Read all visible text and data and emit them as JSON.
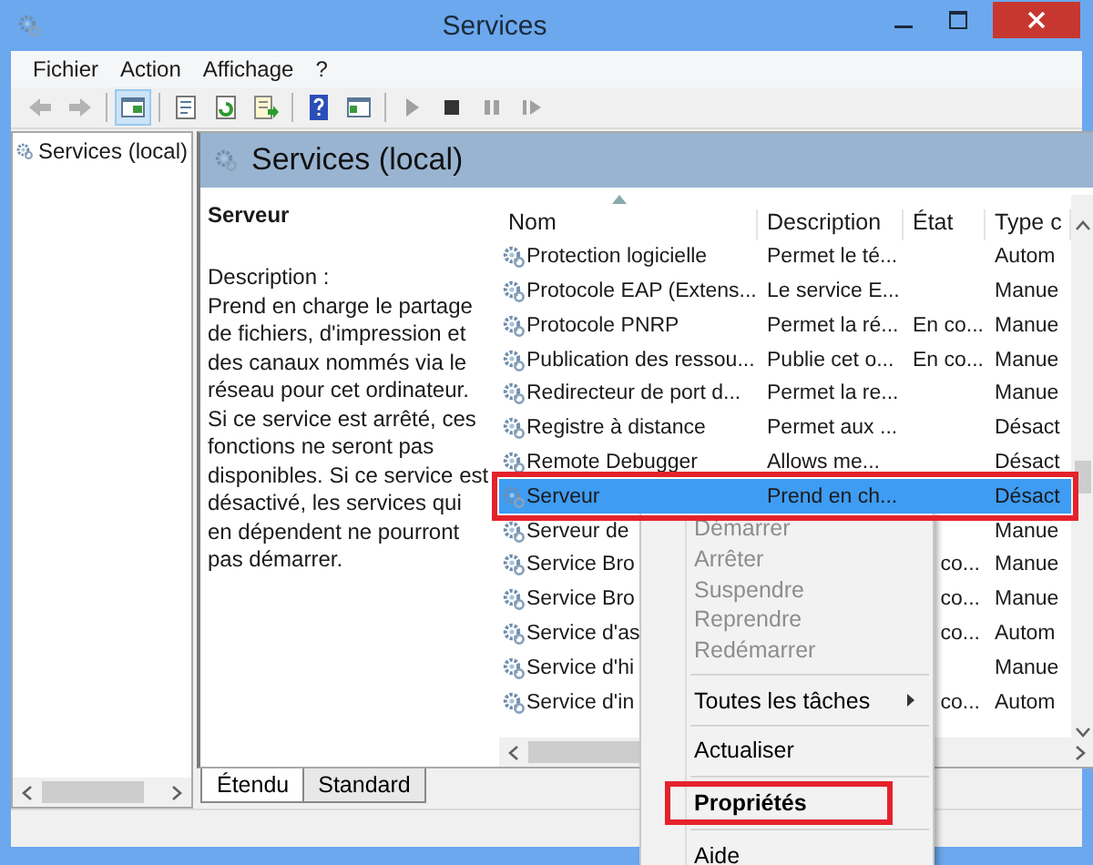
{
  "window": {
    "title": "Services",
    "controls": [
      {
        "kind": "minimize"
      },
      {
        "kind": "maximize"
      },
      {
        "kind": "close"
      }
    ]
  },
  "menu": [
    "Fichier",
    "Action",
    "Affichage",
    "?"
  ],
  "toolbar": [
    {
      "kind": "back",
      "disabled": true,
      "pressed": false
    },
    {
      "kind": "forward",
      "disabled": true,
      "pressed": false
    },
    {
      "kind": "separator"
    },
    {
      "kind": "tree",
      "pressed": true
    },
    {
      "kind": "separator"
    },
    {
      "kind": "properties",
      "pressed": false
    },
    {
      "kind": "refresh",
      "pressed": false
    },
    {
      "kind": "export",
      "pressed": false
    },
    {
      "kind": "separator"
    },
    {
      "kind": "help",
      "pressed": false
    },
    {
      "kind": "pane",
      "pressed": false
    },
    {
      "kind": "separator"
    },
    {
      "kind": "play",
      "disabled": true,
      "pressed": false
    },
    {
      "kind": "stop",
      "disabled": false,
      "pressed": false
    },
    {
      "kind": "pause",
      "disabled": true,
      "pressed": false
    },
    {
      "kind": "resume",
      "disabled": true,
      "pressed": false
    }
  ],
  "tree": {
    "items": [
      "Services (local)"
    ]
  },
  "pane": {
    "title": "Services (local)",
    "service_name": "Serveur",
    "description_label": "Description :",
    "description": "Prend en charge le partage de fichiers, d'impression et des canaux nommés via le réseau pour cet ordinateur. Si ce service est arrêté, ces fonctions ne seront pas disponibles. Si ce service est désactivé, les services qui en dépendent ne pourront pas démarrer."
  },
  "table": {
    "columns": [
      {
        "label": "Nom",
        "sorted": true
      },
      {
        "label": "Description",
        "sorted": false
      },
      {
        "label": "État",
        "sorted": false
      },
      {
        "label": "Type c",
        "sorted": false
      }
    ],
    "rows": [
      {
        "name": "Protection logicielle",
        "description": "Permet le té...",
        "startup": "Autom",
        "selected": false,
        "highlighted": false
      },
      {
        "name": "Protocole EAP (Extens...",
        "description": "Le service E...",
        "startup": "Manue",
        "selected": false,
        "highlighted": false
      },
      {
        "name": "Protocole PNRP",
        "description": "Permet la ré...",
        "state": "En co...",
        "startup": "Manue",
        "selected": false,
        "highlighted": false
      },
      {
        "name": "Publication des ressou...",
        "description": "Publie cet o...",
        "state": "En co...",
        "startup": "Manue",
        "selected": false,
        "highlighted": false
      },
      {
        "name": "Redirecteur de port d...",
        "description": "Permet la re...",
        "startup": "Manue",
        "selected": false,
        "highlighted": false
      },
      {
        "name": "Registre à distance",
        "description": "Permet aux ...",
        "startup": "Désact",
        "selected": false,
        "highlighted": false
      },
      {
        "name": "Remote Debugger",
        "description": "Allows me...",
        "startup": "Désact",
        "selected": false,
        "highlighted": false
      },
      {
        "name": "Serveur",
        "description": "Prend en ch...",
        "startup": "Désact",
        "selected": true,
        "highlighted": true
      },
      {
        "name": "Serveur de",
        "startup": "Manue",
        "selected": false,
        "highlighted": false
      },
      {
        "name": "Service Bro",
        "state": "co...",
        "startup": "Manue",
        "selected": false,
        "highlighted": false
      },
      {
        "name": "Service Bro",
        "state": "co...",
        "startup": "Manue",
        "selected": false,
        "highlighted": false
      },
      {
        "name": "Service d'as",
        "state": "co...",
        "startup": "Autom",
        "selected": false,
        "highlighted": false
      },
      {
        "name": "Service d'hi",
        "startup": "Manue",
        "selected": false,
        "highlighted": false
      },
      {
        "name": "Service d'in",
        "state": "co...",
        "startup": "Autom",
        "selected": false,
        "highlighted": false
      }
    ]
  },
  "view_tabs": [
    {
      "label": "Étendu",
      "selected": true
    },
    {
      "label": "Standard",
      "selected": false
    }
  ],
  "context_menu": [
    {
      "kind": "item",
      "label": "Démarrer",
      "disabled": true,
      "default": false,
      "submenu": false,
      "highlighted": false
    },
    {
      "kind": "item",
      "label": "Arrêter",
      "disabled": true,
      "default": false,
      "submenu": false,
      "highlighted": false
    },
    {
      "kind": "item",
      "label": "Suspendre",
      "disabled": true,
      "default": false,
      "submenu": false,
      "highlighted": false
    },
    {
      "kind": "item",
      "label": "Reprendre",
      "disabled": true,
      "default": false,
      "submenu": false,
      "highlighted": false
    },
    {
      "kind": "item",
      "label": "Redémarrer",
      "disabled": true,
      "default": false,
      "submenu": false,
      "highlighted": false
    },
    {
      "kind": "separator"
    },
    {
      "kind": "item",
      "label": "Toutes les tâches",
      "disabled": false,
      "default": false,
      "submenu": true,
      "highlighted": false
    },
    {
      "kind": "separator"
    },
    {
      "kind": "item",
      "label": "Actualiser",
      "disabled": false,
      "default": false,
      "submenu": false,
      "highlighted": false
    },
    {
      "kind": "separator"
    },
    {
      "kind": "item",
      "label": "Propriétés",
      "disabled": false,
      "default": true,
      "submenu": false,
      "highlighted": true
    },
    {
      "kind": "separator"
    },
    {
      "kind": "item",
      "label": "Aide",
      "disabled": false,
      "default": false,
      "submenu": false,
      "highlighted": false
    }
  ]
}
